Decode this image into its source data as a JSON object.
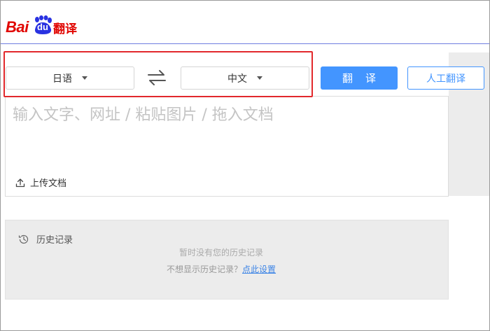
{
  "logo": {
    "bai": "Bai",
    "du": "du",
    "fanyi": "翻译"
  },
  "lang_bar": {
    "source_lang": "日语",
    "target_lang": "中文",
    "swap_icon": "swap-arrows-icon"
  },
  "actions": {
    "translate_label": "翻译",
    "human_translate_label": "人工翻译"
  },
  "input": {
    "placeholder": "输入文字、网址 / 粘贴图片 / 拖入文档",
    "value": "",
    "upload_label": "上传文档"
  },
  "history": {
    "title": "历史记录",
    "empty_text": "暂时没有您的历史记录",
    "hide_prompt": "不想显示历史记录？",
    "settings_link": "点此设置"
  },
  "colors": {
    "brand_red": "#e10601",
    "accent_blue": "#4395ff",
    "highlight_red": "#e2282c"
  }
}
